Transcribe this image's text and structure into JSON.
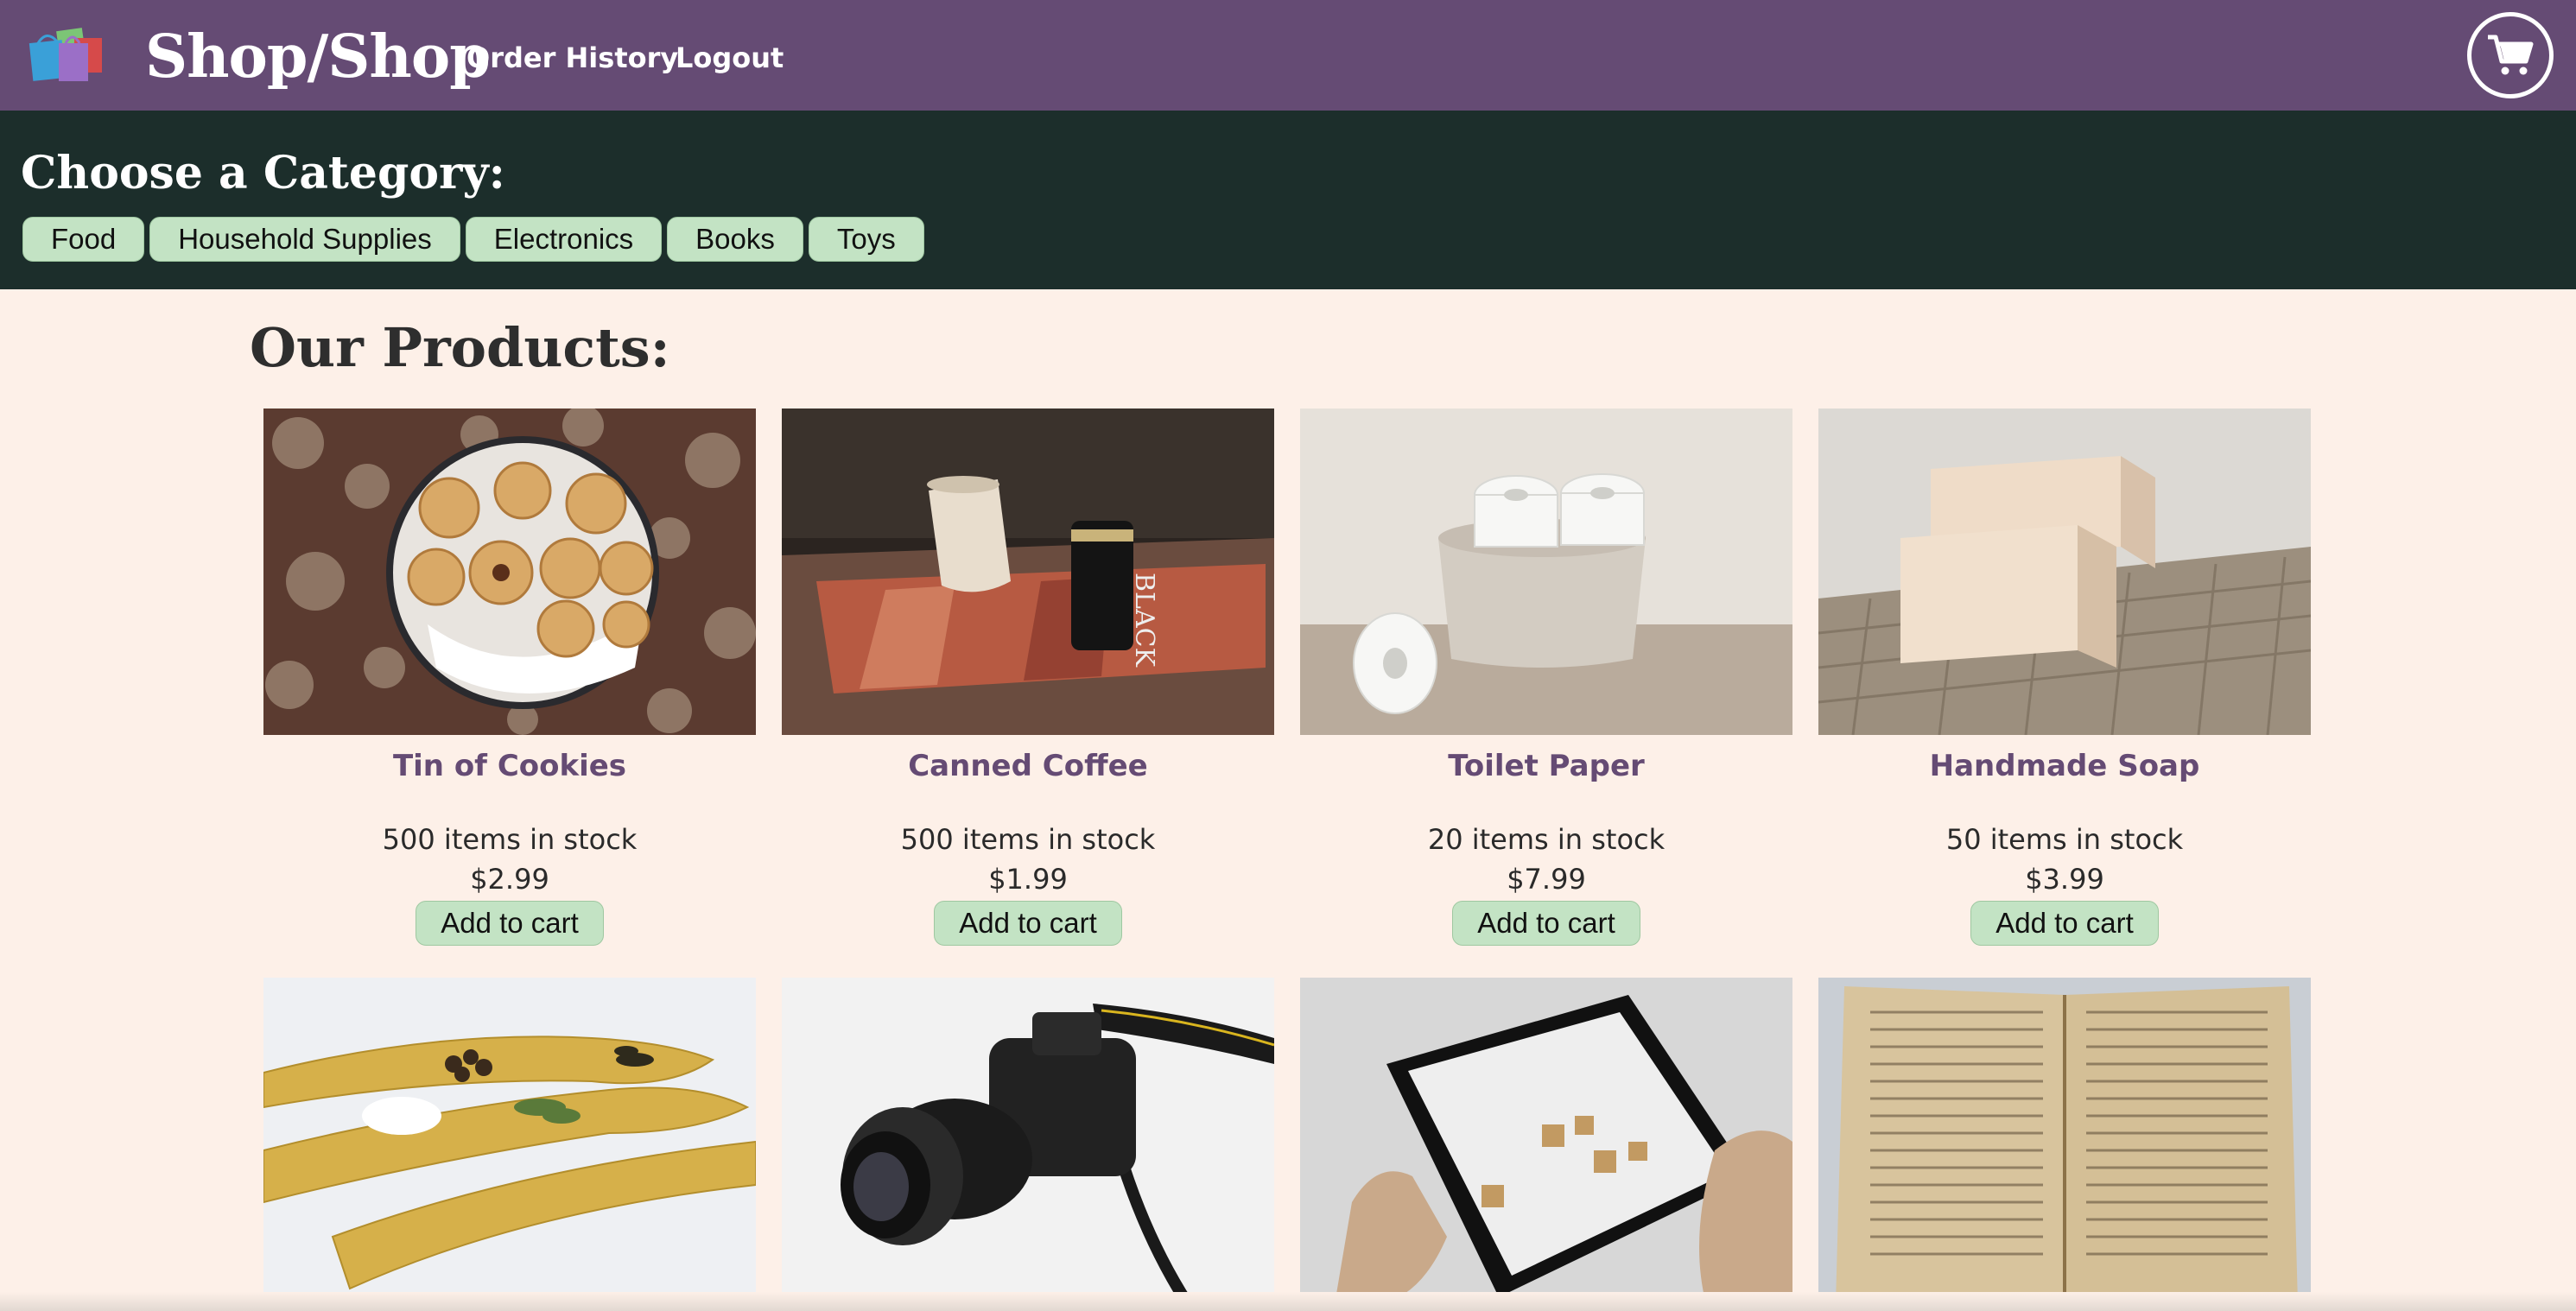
{
  "nav": {
    "brand": "Shop/Shop",
    "links": [
      "Order History",
      "Logout"
    ],
    "logo_icon": "shopping-bags-icon",
    "cart_icon": "cart-icon"
  },
  "categories": {
    "title": "Choose a Category:",
    "items": [
      "Food",
      "Household Supplies",
      "Electronics",
      "Books",
      "Toys"
    ]
  },
  "products": {
    "title": "Our Products:",
    "add_label": "Add to cart",
    "items": [
      {
        "name": "Tin of Cookies",
        "stock": "500 items in stock",
        "price": "$2.99"
      },
      {
        "name": "Canned Coffee",
        "stock": "500 items in stock",
        "price": "$1.99"
      },
      {
        "name": "Toilet Paper",
        "stock": "20 items in stock",
        "price": "$7.99"
      },
      {
        "name": "Handmade Soap",
        "stock": "50 items in stock",
        "price": "$3.99"
      }
    ]
  },
  "colors": {
    "nav_bg": "#654b74",
    "category_bg": "#1c2e2b",
    "page_bg": "#fdf0e8",
    "button_bg": "#c3e3c4"
  }
}
